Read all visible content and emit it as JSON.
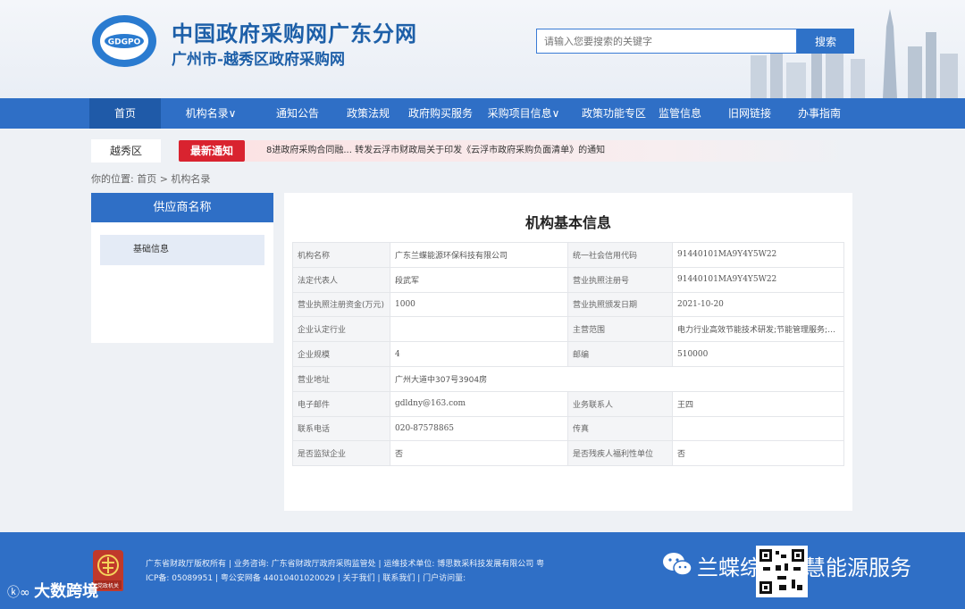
{
  "header": {
    "logo_text": "GDGPO",
    "title": "中国政府采购网广东分网",
    "subtitle": "广州市-越秀区政府采购网",
    "search_placeholder": "请输入您要搜索的关键字",
    "search_button": "搜索"
  },
  "nav": {
    "items": [
      {
        "label": "首页",
        "active": true
      },
      {
        "label": "机构名录∨",
        "active": false
      },
      {
        "label": "通知公告",
        "active": false
      },
      {
        "label": "政策法规",
        "active": false
      },
      {
        "label": "政府购买服务",
        "active": false
      },
      {
        "label": "采购项目信息∨",
        "active": false
      },
      {
        "label": "政策功能专区",
        "active": false
      },
      {
        "label": "监管信息",
        "active": false
      },
      {
        "label": "旧网链接",
        "active": false
      },
      {
        "label": "办事指南",
        "active": false
      }
    ]
  },
  "notice": {
    "district": "越秀区",
    "latest_label": "最新通知",
    "ticker_text": "8进政府采购合同融...   转发云浮市财政局关于印发《云浮市政府采购负面清单》的通知"
  },
  "breadcrumb": "你的位置:  首页 > 机构名录",
  "sidebar": {
    "heading": "供应商名称",
    "item": "基础信息"
  },
  "panel": {
    "title": "机构基本信息",
    "rows": [
      [
        "机构名称",
        "广东兰蝶能源环保科技有限公司",
        "统一社会信用代码",
        "91440101MA9Y4Y5W22"
      ],
      [
        "法定代表人",
        "段武军",
        "营业执照注册号",
        "91440101MA9Y4Y5W22"
      ],
      [
        "营业执照注册资金(万元)",
        "1000",
        "营业执照颁发日期",
        "2021-10-20"
      ],
      [
        "企业认定行业",
        "",
        "主营范围",
        "电力行业高效节能技术研发;节能管理服务;资..."
      ],
      [
        "企业规模",
        "4",
        "邮编",
        "510000"
      ],
      [
        "营业地址",
        "广州大道中307号3904房"
      ],
      [
        "电子邮件",
        "gdldny@163.com",
        "业务联系人",
        "王四"
      ],
      [
        "联系电话",
        "020-87578865",
        "传真",
        ""
      ],
      [
        "是否监狱企业",
        "否",
        "是否残疾人福利性单位",
        "否"
      ]
    ]
  },
  "footer": {
    "line1": "广东省财政厅版权所有   |   业务咨询: 广东省财政厅政府采购监管处   |   运维技术单位: 博思数采科技发展有限公司 粤",
    "line2": "ICP备: 05089951   |   粤公安网备 44010401020029   |   关于我们   |   联系我们   |   门户访问量:",
    "emblem_text": "党政机关",
    "wechat_text": "兰蝶综合智慧能源服务",
    "watermark_text": "大数跨境"
  },
  "colors": {
    "nav_blue": "#2f6fc6",
    "latest_red": "#d9232f",
    "title_blue": "#1d5fa8"
  }
}
